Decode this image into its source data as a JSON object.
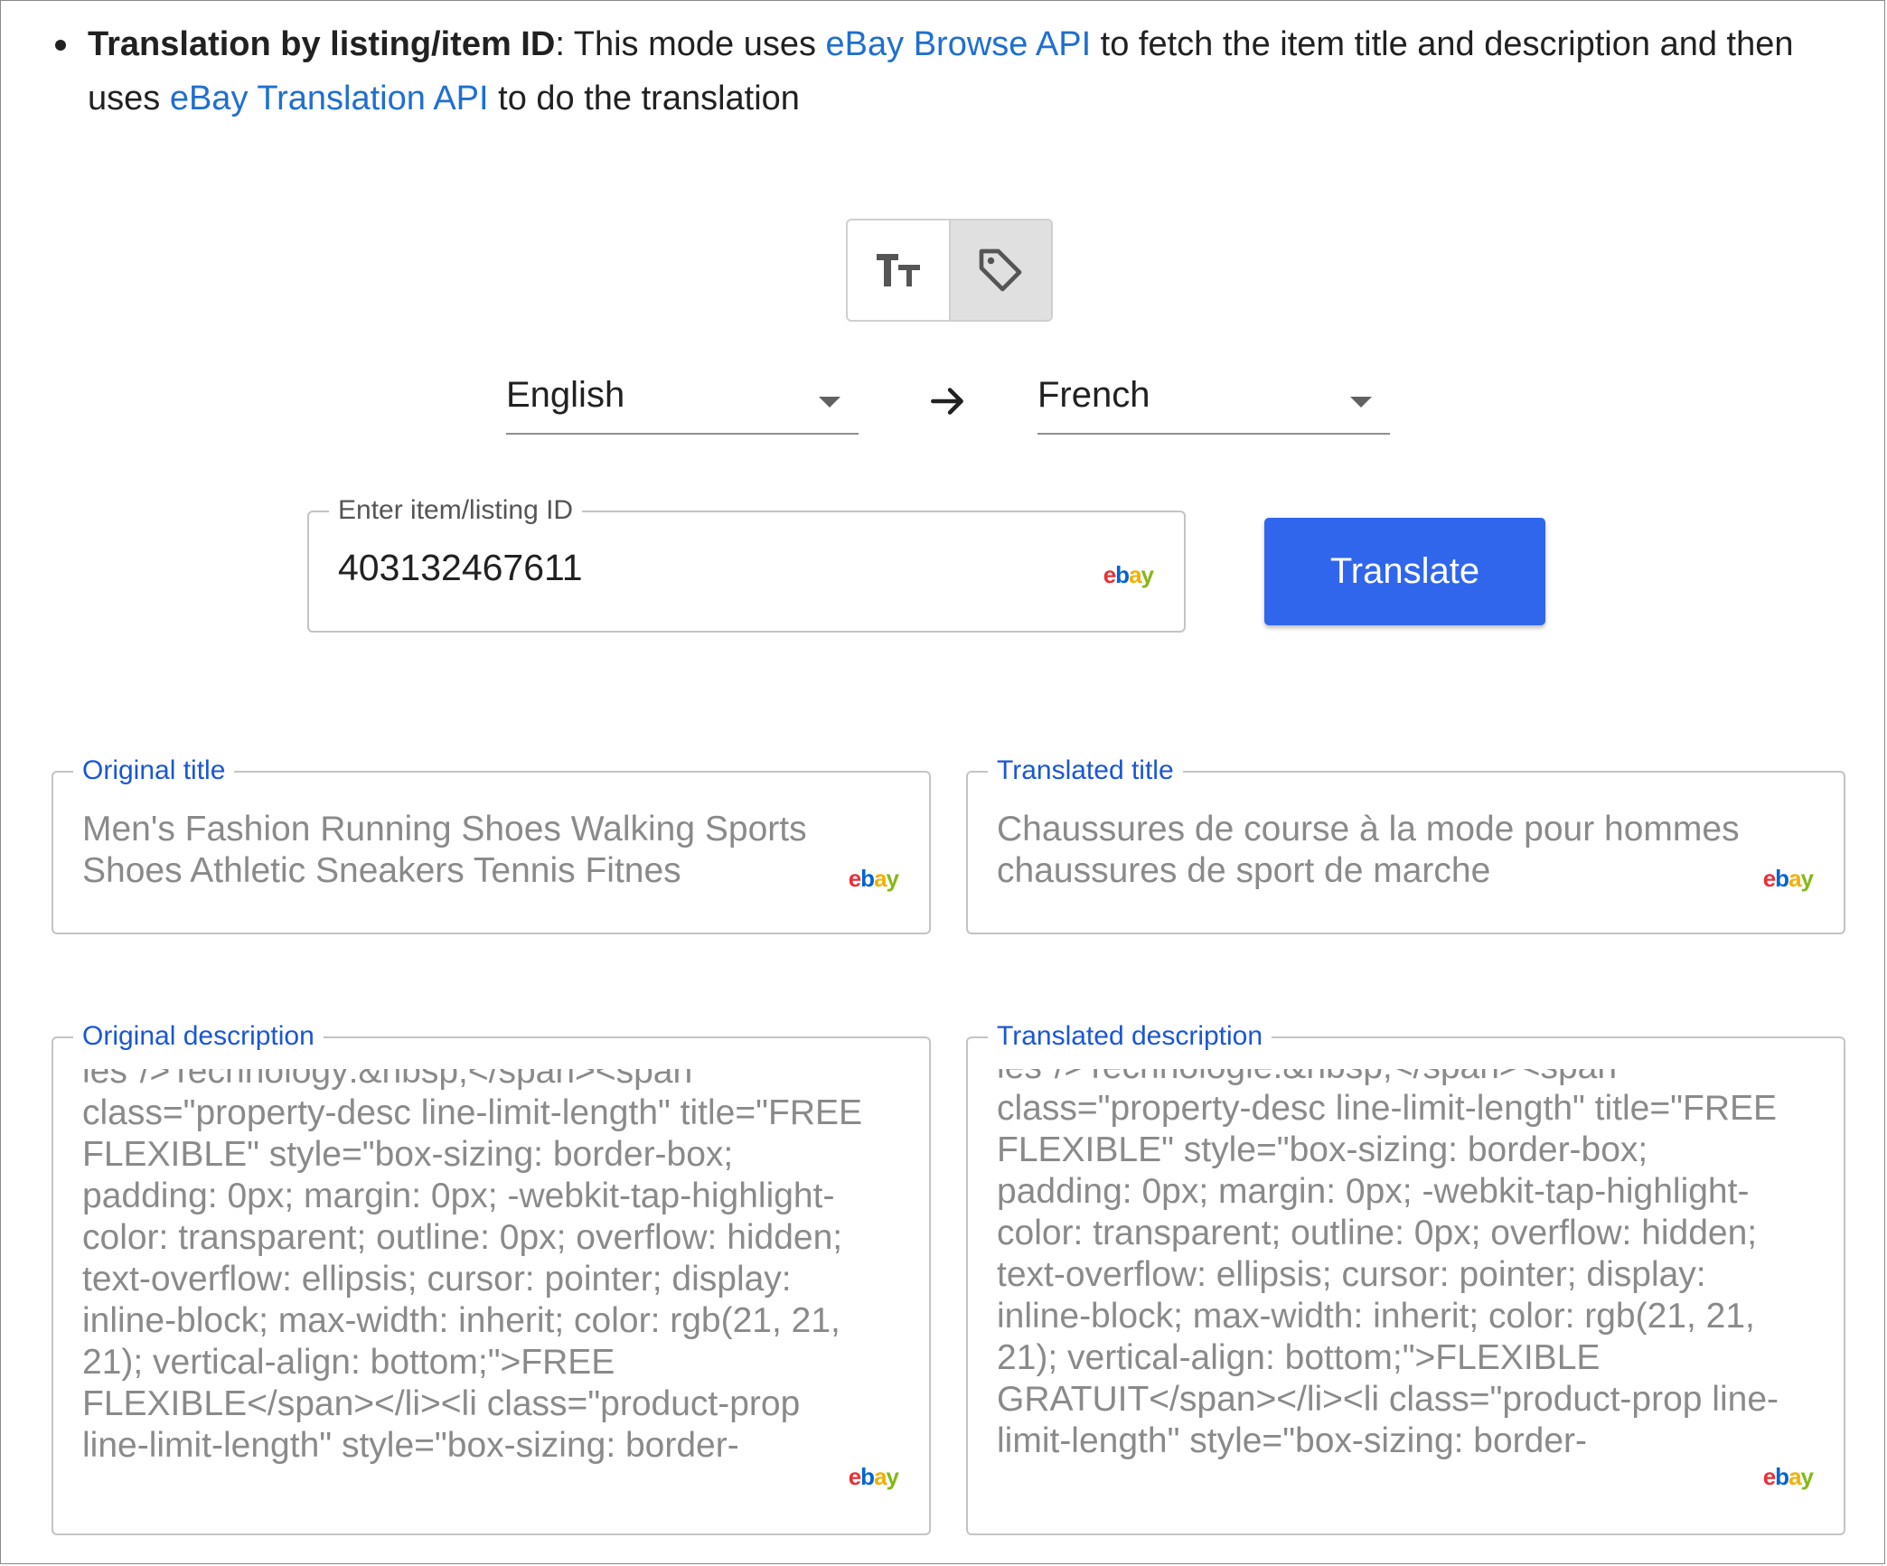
{
  "intro": {
    "bold_label": "Translation by listing/item ID",
    "text_1": ": This mode uses ",
    "link_browse": "eBay Browse API",
    "text_2": " to fetch the item title and description and then uses ",
    "link_translation": "eBay Translation API",
    "text_3": " to do the translation"
  },
  "mode_toggle": {
    "options": [
      {
        "icon": "text-size-icon",
        "active": false
      },
      {
        "icon": "tag-icon",
        "active": true
      }
    ]
  },
  "languages": {
    "source": "English",
    "target": "French",
    "arrow_icon": "arrow-right-icon"
  },
  "item_input": {
    "label": "Enter item/listing ID",
    "value": "403132467611",
    "brand_icon": "ebay-logo"
  },
  "translate_button": {
    "label": "Translate",
    "color": "#2f66ec"
  },
  "original_title": {
    "label": "Original title",
    "text": "Men's Fashion Running Shoes Walking Sports Shoes Athletic Sneakers Tennis Fitnes"
  },
  "translated_title": {
    "label": "Translated title",
    "text": "Chaussures de course à la mode pour hommes chaussures de sport de marche"
  },
  "original_description": {
    "label": "Original description",
    "text": "ies\"/>Technology:&nbsp;</span><span class=\"property-desc line-limit-length\" title=\"FREE FLEXIBLE\" style=\"box-sizing: border-box; padding: 0px; margin: 0px; -webkit-tap-highlight-color: transparent; outline: 0px; overflow: hidden; text-overflow: ellipsis; cursor: pointer; display: inline-block; max-width: inherit; color: rgb(21, 21, 21); vertical-align: bottom;\">FREE FLEXIBLE</span></li><li class=\"product-prop line-limit-length\" style=\"box-sizing: border-"
  },
  "translated_description": {
    "label": "Translated description",
    "text": "ies\"/>Technologie:&nbsp;</span><span class=\"property-desc line-limit-length\" title=\"FREE FLEXIBLE\" style=\"box-sizing: border-box; padding: 0px; margin: 0px; -webkit-tap-highlight-color: transparent; outline: 0px; overflow: hidden; text-overflow: ellipsis; cursor: pointer; display: inline-block; max-width: inherit; color: rgb(21, 21, 21); vertical-align: bottom;\">FLEXIBLE GRATUIT</span></li><li class=\"product-prop line-limit-length\" style=\"box-sizing: border-"
  },
  "brand": {
    "e": "e",
    "b": "b",
    "a": "a",
    "y": "y"
  }
}
